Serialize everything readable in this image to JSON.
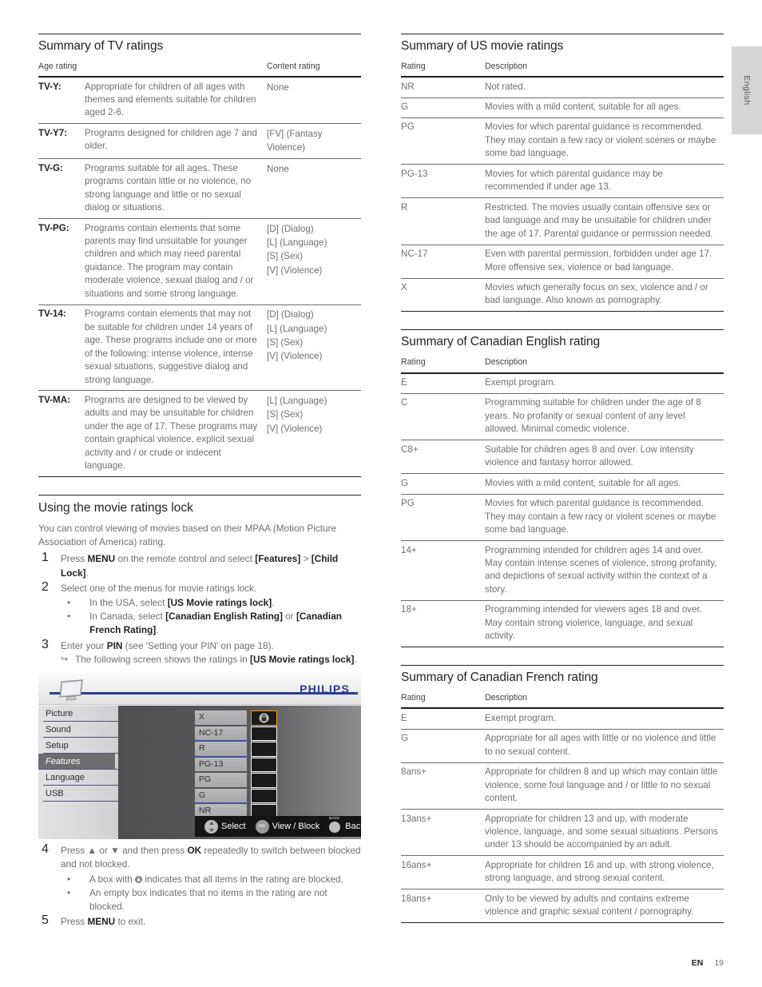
{
  "side_tab": {
    "label": "English"
  },
  "footer": {
    "lang_code": "EN",
    "page_number": "19"
  },
  "tv_ratings": {
    "title": "Summary of TV ratings",
    "headers": {
      "col1": "Age rating",
      "col2": "Content rating"
    },
    "rows": [
      {
        "code": "TV-Y:",
        "desc": "Appropriate for children of all ages with themes and elements suitable for children aged 2-6.",
        "content": "None"
      },
      {
        "code": "TV-Y7:",
        "desc": "Programs designed for children age 7 and older.",
        "content": "[FV] (Fantasy Violence)"
      },
      {
        "code": "TV-G:",
        "desc": "Programs suitable for all ages. These programs contain little or no violence, no strong language and little or no sexual dialog or situations.",
        "content": "None"
      },
      {
        "code": "TV-PG:",
        "desc": "Programs contain elements that some parents may find unsuitable for younger children and which may need parental guidance. The program may contain moderate violence, sexual dialog and / or situations and some strong language.",
        "content": "[D] (Dialog)\n[L] (Language)\n[S] (Sex)\n[V] (Violence)"
      },
      {
        "code": "TV-14:",
        "desc": "Programs contain elements that may not be suitable for children under 14 years of age. These programs include one or more of the following: intense violence, intense sexual situations, suggestive dialog and strong language.",
        "content": "[D] (Dialog)\n[L] (Language)\n[S] (Sex)\n[V] (Violence)"
      },
      {
        "code": "TV-MA:",
        "desc": "Programs are designed to be viewed by adults and may be unsuitable for children under the age of 17. These programs may contain graphical violence, explicit sexual activity and / or crude or indecent language.",
        "content": "[L] (Language)\n[S] (Sex)\n[V] (Violence)"
      }
    ]
  },
  "movie_lock": {
    "title": "Using the movie ratings lock",
    "intro": "You can control viewing of movies based on their MPAA (Motion Picture Association of America) rating.",
    "steps": [
      {
        "num": "1",
        "parts": [
          {
            "t": "Press ",
            "b": false
          },
          {
            "t": "MENU",
            "b": true
          },
          {
            "t": " on the remote control and select ",
            "b": false
          },
          {
            "t": "[Features]",
            "b": true
          },
          {
            "t": " > ",
            "b": false
          },
          {
            "t": "[Child Lock]",
            "b": true
          },
          {
            "t": ".",
            "b": false
          }
        ]
      },
      {
        "num": "2",
        "parts": [
          {
            "t": "Select one of the menus for movie ratings lock.",
            "b": false
          }
        ],
        "sub": [
          [
            {
              "t": "In the USA, select ",
              "b": false
            },
            {
              "t": "[US Movie ratings lock]",
              "b": true
            },
            {
              "t": ".",
              "b": false
            }
          ],
          [
            {
              "t": "In Canada, select ",
              "b": false
            },
            {
              "t": "[Canadian English Rating]",
              "b": true
            },
            {
              "t": " or ",
              "b": false
            },
            {
              "t": "[Canadian French Rating]",
              "b": true
            },
            {
              "t": ".",
              "b": false
            }
          ]
        ]
      },
      {
        "num": "3",
        "parts": [
          {
            "t": "Enter your ",
            "b": false
          },
          {
            "t": "PIN",
            "b": true
          },
          {
            "t": " (see 'Setting your PIN' on page 18).",
            "b": false
          }
        ],
        "arrow": [
          {
            "t": "The following screen shows the ratings in ",
            "b": false
          },
          {
            "t": "[US Movie ratings lock]",
            "b": true
          },
          {
            "t": ".",
            "b": false
          }
        ]
      },
      {
        "num": "4",
        "parts": [
          {
            "t": "Press ",
            "b": false
          },
          {
            "t": "▲",
            "b": false
          },
          {
            "t": " or ",
            "b": false
          },
          {
            "t": "▼",
            "b": false
          },
          {
            "t": " and then press ",
            "b": false
          },
          {
            "t": "OK",
            "b": true
          },
          {
            "t": " repeatedly to switch between blocked and not blocked.",
            "b": false
          }
        ],
        "sub": [
          [
            {
              "t": "A box with ",
              "b": false
            },
            {
              "t": "[lock-icon]",
              "b": false
            },
            {
              "t": " indicates that all items in the rating are blocked.",
              "b": false
            }
          ],
          [
            {
              "t": "An empty box indicates that no items in the rating are not blocked.",
              "b": false
            }
          ]
        ]
      },
      {
        "num": "5",
        "parts": [
          {
            "t": "Press ",
            "b": false
          },
          {
            "t": "MENU",
            "b": true
          },
          {
            "t": " to exit.",
            "b": false
          }
        ]
      }
    ]
  },
  "tv_screenshot": {
    "brand": "PHILIPS",
    "menu_items": [
      {
        "label": "Picture",
        "selected": false
      },
      {
        "label": "Sound",
        "selected": false
      },
      {
        "label": "Setup",
        "selected": false
      },
      {
        "label": "Features",
        "selected": true
      },
      {
        "label": "Language",
        "selected": false
      },
      {
        "label": "USB",
        "selected": false
      }
    ],
    "ratings": [
      {
        "label": "X",
        "blocked": true
      },
      {
        "label": "NC-17",
        "blocked": false
      },
      {
        "label": "R",
        "blocked": false
      },
      {
        "label": "PG-13",
        "blocked": false
      },
      {
        "label": "PG",
        "blocked": false
      },
      {
        "label": "G",
        "blocked": false
      },
      {
        "label": "NR",
        "blocked": false
      }
    ],
    "controls": [
      {
        "icon": "dpad-icon",
        "label": "Select"
      },
      {
        "icon": "ok-button-icon",
        "label": "View / Block"
      },
      {
        "icon": "back-button-icon",
        "label": "Back",
        "badge": "BACK"
      }
    ],
    "colors": {
      "brand_blue": "#2b3c96",
      "highlight": "#e8a317",
      "selected_row": "#6e6e70"
    }
  },
  "us_movie": {
    "title": "Summary of US movie ratings",
    "headers": {
      "col1": "Rating",
      "col2": "Description"
    },
    "rows": [
      {
        "code": "NR",
        "desc": "Not rated."
      },
      {
        "code": "G",
        "desc": "Movies with a mild content, suitable for all ages."
      },
      {
        "code": "PG",
        "desc": "Movies for which parental guidance is recommended. They may contain a few racy or violent scenes or maybe some bad language."
      },
      {
        "code": "PG-13",
        "desc": "Movies for which parental guidance may be recommended if under age 13."
      },
      {
        "code": "R",
        "desc": "Restricted. The movies usually contain offensive sex or bad language and may be unsuitable for children under the age of 17. Parental guidance or permission needed."
      },
      {
        "code": "NC-17",
        "desc": "Even with parental permission, forbidden under age 17. More offensive sex, violence or bad language."
      },
      {
        "code": "X",
        "desc": "Movies which generally focus on sex, violence and / or bad language. Also known as pornography."
      }
    ]
  },
  "canadian_english": {
    "title": "Summary of Canadian English rating",
    "headers": {
      "col1": "Rating",
      "col2": "Description"
    },
    "rows": [
      {
        "code": "E",
        "desc": "Exempt program."
      },
      {
        "code": "C",
        "desc": "Programming suitable for children under the age of 8 years. No profanity or sexual content of any level allowed. Minimal comedic violence."
      },
      {
        "code": "C8+",
        "desc": "Suitable for children ages 8 and over. Low intensity violence and fantasy horror allowed."
      },
      {
        "code": "G",
        "desc": "Movies with a mild content, suitable for all ages."
      },
      {
        "code": "PG",
        "desc": "Movies for which parental guidance is recommended. They may contain a few racy or violent scenes or maybe some bad language."
      },
      {
        "code": "14+",
        "desc": "Programming intended for children ages 14 and over. May contain intense scenes of violence, strong profanity, and depictions of sexual activity within the context of a story."
      },
      {
        "code": "18+",
        "desc": "Programming intended for viewers ages 18 and over. May contain strong violence, language, and sexual activity."
      }
    ]
  },
  "canadian_french": {
    "title": "Summary of Canadian French rating",
    "headers": {
      "col1": "Rating",
      "col2": "Description"
    },
    "rows": [
      {
        "code": "E",
        "desc": "Exempt program."
      },
      {
        "code": "G",
        "desc": "Appropriate for all ages with little or no violence and little to no sexual content."
      },
      {
        "code": "8ans+",
        "desc": "Appropriate for children 8 and up which may contain little violence, some foul language and / or little to no sexual content."
      },
      {
        "code": "13ans+",
        "desc": "Appropriate for children 13 and up, with moderate violence, language, and some sexual situations. Persons under 13 should be accompanied by an adult."
      },
      {
        "code": "16ans+",
        "desc": "Appropriate for children 16 and up, with strong violence, strong language, and strong sexual content."
      },
      {
        "code": "18ans+",
        "desc": "Only to be viewed by adults and contains extreme violence and graphic sexual content / pornography."
      }
    ]
  }
}
